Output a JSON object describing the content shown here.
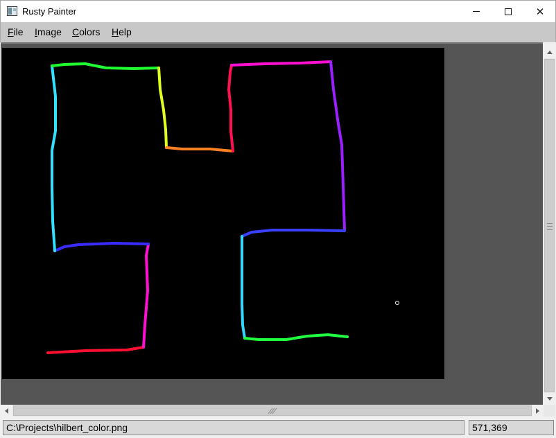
{
  "window": {
    "title": "Rusty Painter",
    "minimize_glyph": "",
    "maximize_glyph": "",
    "close_glyph": "✕"
  },
  "menu": {
    "file": {
      "mnemonic": "F",
      "rest": "ile"
    },
    "image": {
      "mnemonic": "I",
      "rest": "mage"
    },
    "colors": {
      "mnemonic": "C",
      "rest": "olors"
    },
    "help": {
      "mnemonic": "H",
      "rest": "elp"
    }
  },
  "status": {
    "file_path": "C:\\Projects\\hilbert_color.png",
    "cursor_position": "571,369"
  },
  "colors": {
    "canvas_background": "#000000",
    "workspace_background": "#555555",
    "menubar_background": "#c8c8c8"
  },
  "icons": {
    "app": "app-icon",
    "minimize": "minimize-icon",
    "maximize": "maximize-icon",
    "close": "close-icon",
    "cursor": "brush-cursor-icon"
  }
}
